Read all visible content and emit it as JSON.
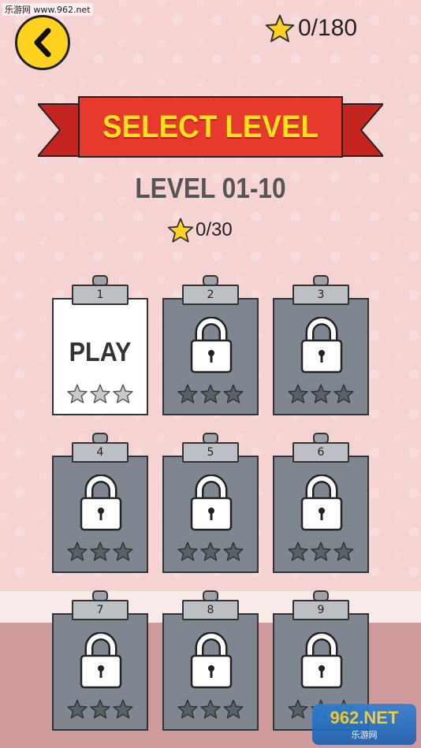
{
  "watermark_top": "乐游网 www.962.net",
  "header": {
    "back_icon": "chevron-left-icon",
    "total_stars_text": "0/180"
  },
  "banner": {
    "title": "SELECT LEVEL"
  },
  "level_group": {
    "range_title": "LEVEL 01-10",
    "stars_text": "0/30"
  },
  "levels": [
    {
      "number": "1",
      "state": "unlocked",
      "label": "PLAY",
      "stars": 0
    },
    {
      "number": "2",
      "state": "locked",
      "stars": 0
    },
    {
      "number": "3",
      "state": "locked",
      "stars": 0
    },
    {
      "number": "4",
      "state": "locked",
      "stars": 0
    },
    {
      "number": "5",
      "state": "locked",
      "stars": 0
    },
    {
      "number": "6",
      "state": "locked",
      "stars": 0
    },
    {
      "number": "7",
      "state": "locked",
      "stars": 0
    },
    {
      "number": "8",
      "state": "locked",
      "stars": 0
    },
    {
      "number": "9",
      "state": "locked",
      "stars": 0
    }
  ],
  "watermark_bottom": {
    "brand": "962.NET",
    "sub": "乐游网"
  },
  "colors": {
    "background": "#f6d3d3",
    "back_button": "#ffd21f",
    "banner_red": "#e8392e",
    "banner_text": "#ffe01c",
    "locked_board": "#7f868f",
    "unlocked_board": "#ffffff",
    "star_gold": "#ffd21f"
  }
}
